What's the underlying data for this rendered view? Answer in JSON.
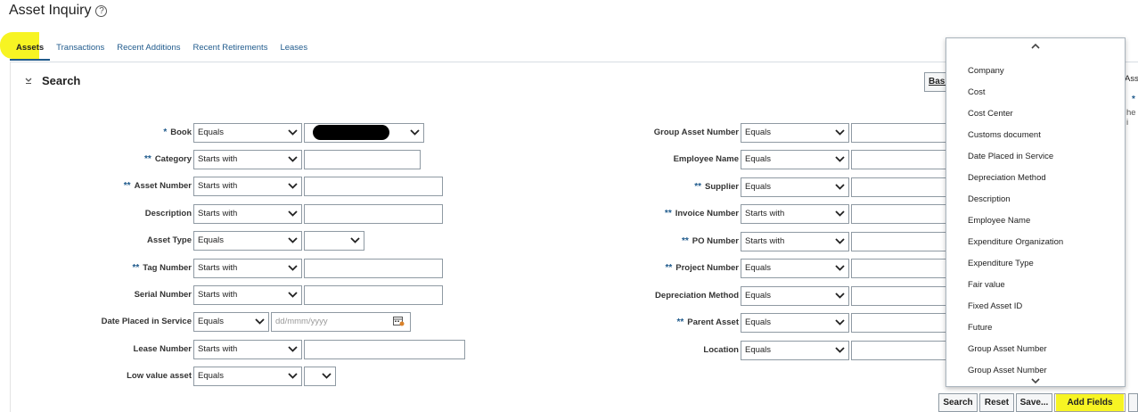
{
  "page": {
    "title": "Asset Inquiry"
  },
  "tabs": [
    {
      "label": "Assets",
      "active": true
    },
    {
      "label": "Transactions"
    },
    {
      "label": "Recent Additions"
    },
    {
      "label": "Recent Retirements"
    },
    {
      "label": "Leases"
    }
  ],
  "search": {
    "title": "Search",
    "basic_label": "Basic",
    "right_clip_1": "Asse",
    "right_clip_2": "he i",
    "right_star": "*"
  },
  "left_fields": [
    {
      "label": "Book",
      "req": "*",
      "op": "Equals",
      "value": "",
      "type": "select"
    },
    {
      "label": "Category",
      "req": "**",
      "op": "Starts with",
      "value": ""
    },
    {
      "label": "Asset Number",
      "req": "**",
      "op": "Starts with",
      "value": ""
    },
    {
      "label": "Description",
      "req": "",
      "op": "Starts with",
      "value": ""
    },
    {
      "label": "Asset Type",
      "req": "",
      "op": "Equals",
      "value": "",
      "type": "select"
    },
    {
      "label": "Tag Number",
      "req": "**",
      "op": "Starts with",
      "value": ""
    },
    {
      "label": "Serial Number",
      "req": "",
      "op": "Starts with",
      "value": ""
    },
    {
      "label": "Date Placed in Service",
      "req": "",
      "op": "Equals",
      "value": "",
      "placeholder": "dd/mmm/yyyy"
    },
    {
      "label": "Lease Number",
      "req": "",
      "op": "Starts with",
      "value": ""
    },
    {
      "label": "Low value asset",
      "req": "",
      "op": "Equals",
      "value": "",
      "type": "select"
    }
  ],
  "right_fields": [
    {
      "label": "Group Asset Number",
      "req": "",
      "op": "Equals"
    },
    {
      "label": "Employee Name",
      "req": "",
      "op": "Equals"
    },
    {
      "label": "Supplier",
      "req": "**",
      "op": "Equals"
    },
    {
      "label": "Invoice Number",
      "req": "**",
      "op": "Starts with"
    },
    {
      "label": "PO Number",
      "req": "**",
      "op": "Starts with"
    },
    {
      "label": "Project Number",
      "req": "**",
      "op": "Equals"
    },
    {
      "label": "Depreciation Method",
      "req": "",
      "op": "Equals"
    },
    {
      "label": "Parent Asset",
      "req": "**",
      "op": "Equals"
    },
    {
      "label": "Location",
      "req": "",
      "op": "Equals"
    }
  ],
  "add_fields_menu": [
    "Company",
    "Cost",
    "Cost Center",
    "Customs document",
    "Date Placed in Service",
    "Depreciation Method",
    "Description",
    "Employee Name",
    "Expenditure Organization",
    "Expenditure Type",
    "Fair value",
    "Fixed Asset ID",
    "Future",
    "Group Asset Number",
    "Group Asset Number"
  ],
  "buttons": {
    "search": "Search",
    "reset": "Reset",
    "save": "Save...",
    "add_fields": "Add Fields"
  },
  "colors": {
    "highlight": "#f7f423",
    "link": "#1f5a8c"
  }
}
